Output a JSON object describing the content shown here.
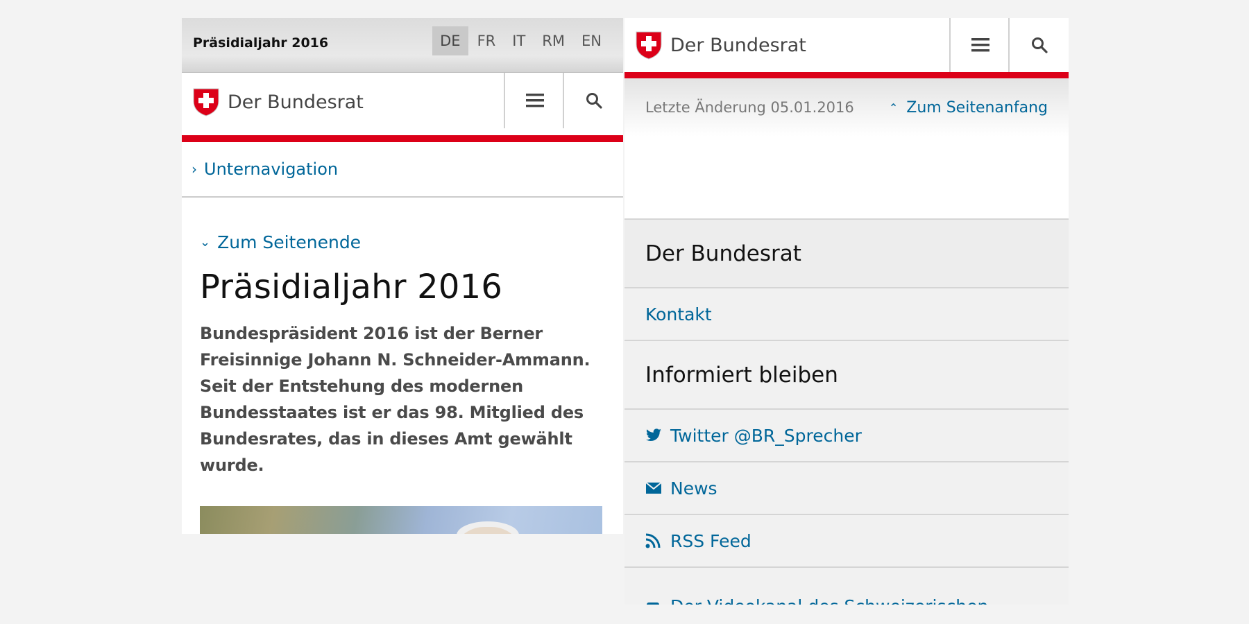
{
  "left": {
    "topbar": {
      "title": "Präsidialjahr 2016",
      "languages": [
        "DE",
        "FR",
        "IT",
        "RM",
        "EN"
      ],
      "active_language": "DE"
    },
    "header": {
      "brand": "Der Bundesrat"
    },
    "subnav": {
      "label": "Unternavigation"
    },
    "content": {
      "jump_link": "Zum Seitenende",
      "title": "Präsidialjahr 2016",
      "lead": "Bundespräsident 2016 ist der Berner Freisinnige Johann N. Schneider-Ammann. Seit der Entstehung des modernen Bundesstaates ist er das 98. Mitglied des Bundesrates, das in dieses Amt gewählt wurde."
    }
  },
  "right": {
    "header": {
      "brand": "Der Bundesrat"
    },
    "meta": {
      "last_changed": "Letzte Änderung 05.01.2016",
      "to_top": "Zum Seitenanfang"
    },
    "footer": {
      "section1_heading": "Der Bundesrat",
      "contact": "Kontakt",
      "section2_heading": "Informiert bleiben",
      "links": [
        {
          "label": "Twitter @BR_Sprecher",
          "icon": "twitter-icon"
        },
        {
          "label": "News",
          "icon": "mail-icon"
        },
        {
          "label": "RSS Feed",
          "icon": "rss-icon"
        },
        {
          "label": "Der Videokanal des Schweizerischen",
          "icon": "youtube-icon"
        }
      ]
    }
  },
  "colors": {
    "accent_red": "#dc0018",
    "link_blue": "#006699",
    "background": "#f3f3f3"
  }
}
